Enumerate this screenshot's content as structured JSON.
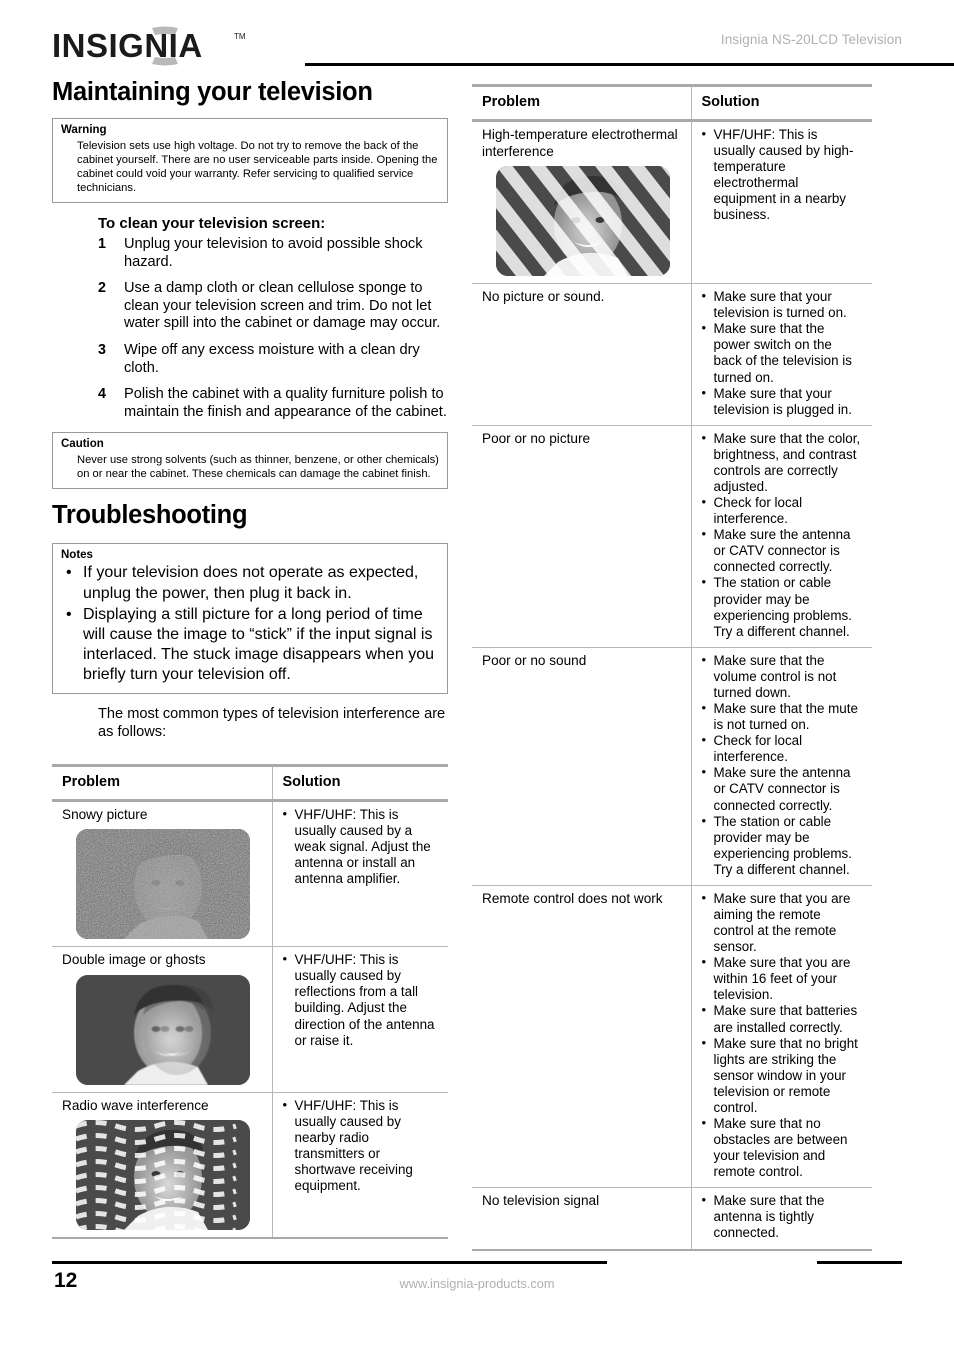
{
  "header": {
    "logo_text": "INSIGNIA",
    "logo_tm": "TM",
    "doc_title": "Insignia NS-20LCD Television"
  },
  "left": {
    "section_title": "Maintaining your television",
    "warning": {
      "label": "Warning",
      "text": "Television sets use high voltage. Do not try to remove the back of the cabinet yourself. There are no user serviceable parts inside. Opening the cabinet could void your warranty. Refer servicing to qualified service technicians."
    },
    "procedure": {
      "heading": "To clean your television screen:",
      "steps": [
        {
          "num": "1",
          "text": "Unplug your television to avoid possible shock hazard."
        },
        {
          "num": "2",
          "text": "Use a damp cloth or clean cellulose sponge to clean your television screen and trim. Do not let water spill into the cabinet or damage may occur."
        },
        {
          "num": "3",
          "text": "Wipe off any excess moisture with a clean dry cloth."
        },
        {
          "num": "4",
          "text": "Polish the cabinet with a quality furniture polish to maintain the finish and appearance of the cabinet."
        }
      ]
    },
    "caution": {
      "label": "Caution",
      "text": "Never use strong solvents (such as thinner, benzene, or other chemicals) on or near the cabinet. These chemicals can damage the cabinet finish."
    },
    "troubleshooting_title": "Troubleshooting",
    "notes": {
      "label": "Notes",
      "bullet": "•",
      "items": [
        "If your television does not operate as expected, unplug the power, then plug it back in.",
        "Displaying a still picture for a long period of time will cause the image to “stick” if the input signal is interlaced. The stuck image disappears when you briefly turn your television off."
      ]
    },
    "intro_paragraph": "The most common types of television interference are as follows:",
    "table": {
      "headers": [
        "Problem",
        "Solution"
      ],
      "bullet": "•",
      "rows": [
        {
          "problem": "Snowy picture",
          "figure": "snowy-picture-figure",
          "solutions": [
            "VHF/UHF: This is usually caused by a weak signal. Adjust the antenna or install an antenna amplifier."
          ]
        },
        {
          "problem": "Double image or ghosts",
          "figure": "double-image-figure",
          "solutions": [
            "VHF/UHF: This is usually caused by reflections from a tall building. Adjust the direction of the antenna or raise it."
          ]
        },
        {
          "problem": "Radio wave interference",
          "figure": "radio-wave-figure",
          "solutions": [
            "VHF/UHF: This is usually caused by nearby radio transmitters or shortwave receiving equipment."
          ]
        }
      ]
    }
  },
  "right": {
    "table": {
      "headers": [
        "Problem",
        "Solution"
      ],
      "bullet": "•",
      "rows": [
        {
          "problem": "High-temperature electrothermal interference",
          "figure": "electrothermal-figure",
          "solutions": [
            "VHF/UHF: This is usually caused by high-temperature electrothermal equipment in a nearby business."
          ]
        },
        {
          "problem": "No picture or sound.",
          "figure": null,
          "solutions": [
            "Make sure that your television is turned on.",
            "Make sure that the power switch on the back of the television is turned on.",
            "Make sure that your television is plugged in."
          ]
        },
        {
          "problem": "Poor or no picture",
          "figure": null,
          "solutions": [
            "Make sure that the color, brightness, and contrast controls are correctly adjusted.",
            "Check for local interference.",
            "Make sure the antenna or CATV connector is connected correctly.",
            "The station or cable provider may be experiencing problems. Try a different channel."
          ]
        },
        {
          "problem": "Poor or no sound",
          "figure": null,
          "solutions": [
            "Make sure that the volume control is not turned down.",
            "Make sure that the mute is not turned on.",
            "Check for local interference.",
            "Make sure the antenna or CATV connector is connected correctly.",
            "The station or cable provider may be experiencing problems. Try a different channel."
          ]
        },
        {
          "problem": "Remote control does not work",
          "figure": null,
          "solutions": [
            "Make sure that you are aiming the remote control at the remote sensor.",
            "Make sure that you are within 16 feet of your television.",
            "Make sure that batteries are installed correctly.",
            "Make sure that no bright lights are striking the sensor window in your television or remote control.",
            "Make sure that no obstacles are between your television and remote control."
          ]
        },
        {
          "problem": "No television signal",
          "figure": null,
          "solutions": [
            "Make sure that the antenna is tightly connected."
          ]
        }
      ]
    }
  },
  "footer": {
    "page_number": "12",
    "url": "www.insignia-products.com"
  },
  "colors": {
    "rule": "#000000",
    "muted_text": "#b0b0b0",
    "table_border": "#b7b7b7",
    "table_heavy_border": "#a9a9a9"
  }
}
